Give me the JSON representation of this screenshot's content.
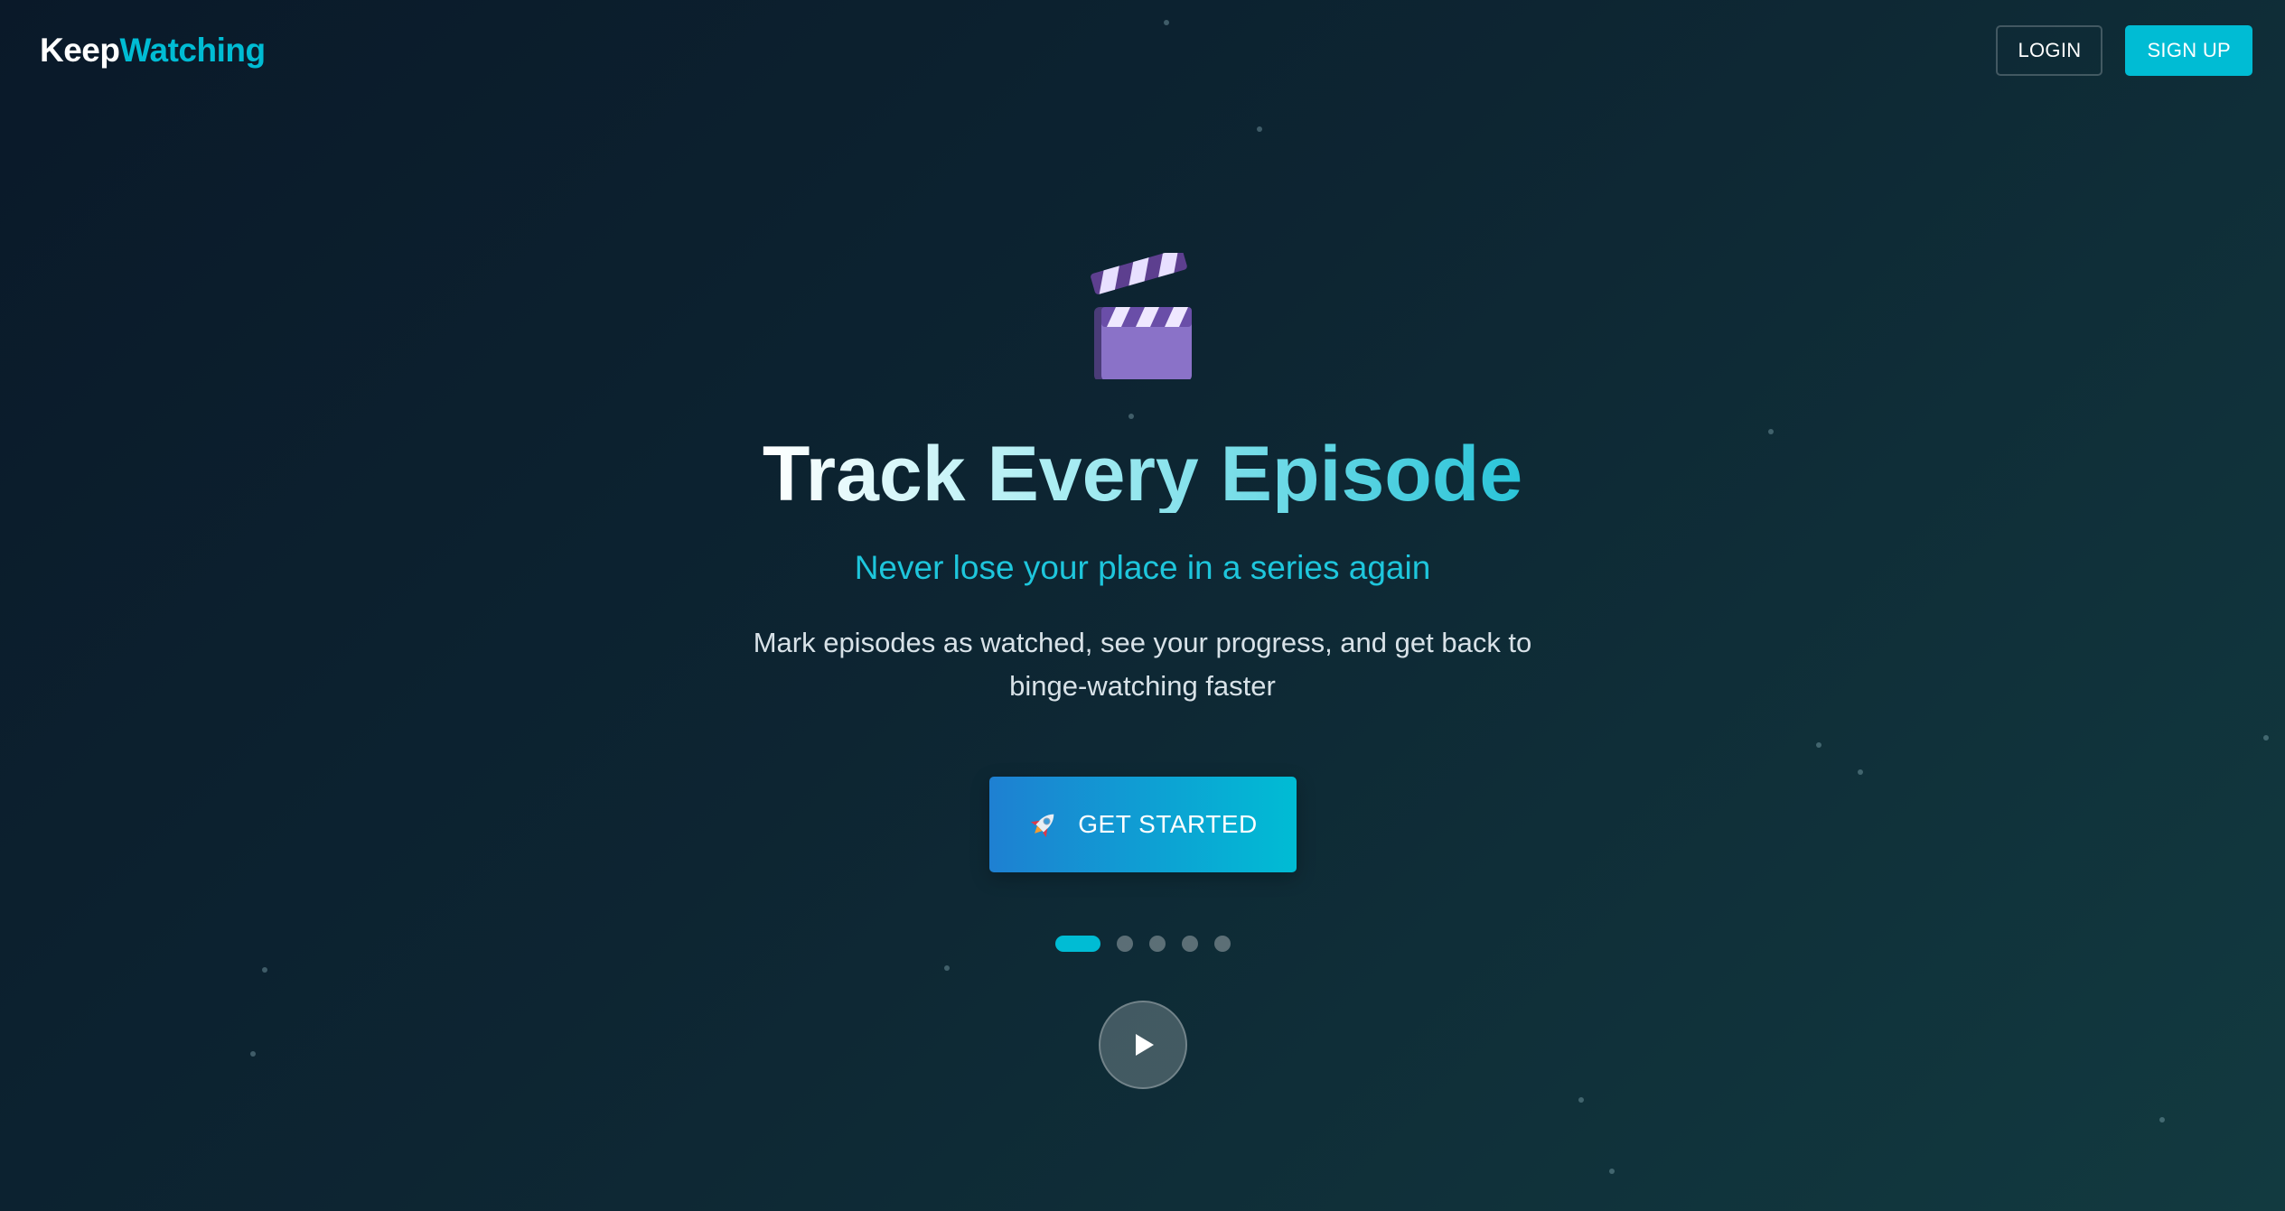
{
  "header": {
    "logo": {
      "part1": "Keep",
      "part2": "Watching"
    },
    "login_label": "LOGIN",
    "signup_label": "SIGN UP"
  },
  "hero": {
    "icon": "clapperboard-icon",
    "title": "Track Every Episode",
    "subtitle": "Never lose your place in a series again",
    "description": "Mark episodes as watched, see your progress, and get back to binge-watching faster",
    "cta": {
      "icon": "rocket-icon",
      "label": "GET STARTED"
    },
    "carousel": {
      "total": 5,
      "active": 1
    },
    "play_icon": "play-icon"
  },
  "colors": {
    "accent": "#00bcd4",
    "background_start": "#0a1929",
    "background_end": "#123a40",
    "cta_gradient_start": "#1e80d2",
    "cta_gradient_end": "#00bcd4"
  }
}
